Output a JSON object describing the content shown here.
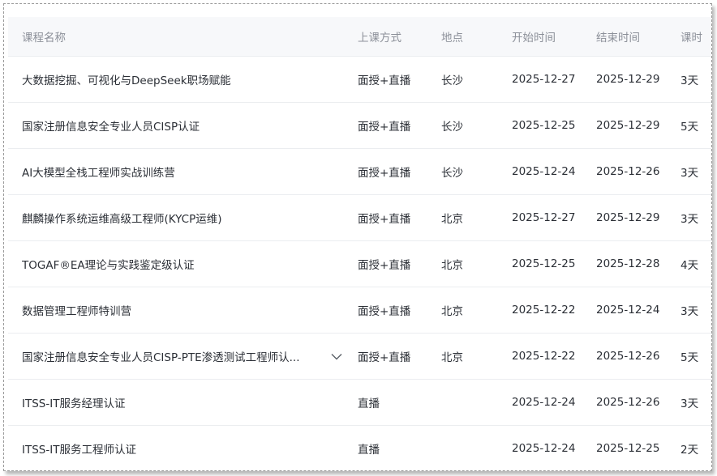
{
  "columns": {
    "name": "课程名称",
    "mode": "上课方式",
    "location": "地点",
    "start": "开始时间",
    "end": "结束时间",
    "days": "课时"
  },
  "rows": [
    {
      "name": "大数据挖掘、可视化与DeepSeek职场赋能",
      "mode": "面授+直播",
      "location": "长沙",
      "start": "2025-12-27",
      "end": "2025-12-29",
      "days": "3天"
    },
    {
      "name": "国家注册信息安全专业人员CISP认证",
      "mode": "面授+直播",
      "location": "长沙",
      "start": "2025-12-25",
      "end": "2025-12-29",
      "days": "5天"
    },
    {
      "name": "AI大模型全栈工程师实战训练营",
      "mode": "面授+直播",
      "location": "长沙",
      "start": "2025-12-24",
      "end": "2025-12-26",
      "days": "3天"
    },
    {
      "name": "麒麟操作系统运维高级工程师(KYCP运维)",
      "mode": "面授+直播",
      "location": "北京",
      "start": "2025-12-27",
      "end": "2025-12-29",
      "days": "3天"
    },
    {
      "name": "TOGAF®EA理论与实践鉴定级认证",
      "mode": "面授+直播",
      "location": "北京",
      "start": "2025-12-25",
      "end": "2025-12-28",
      "days": "4天"
    },
    {
      "name": "数据管理工程师特训营",
      "mode": "面授+直播",
      "location": "北京",
      "start": "2025-12-22",
      "end": "2025-12-24",
      "days": "3天"
    },
    {
      "name": "国家注册信息安全专业人员CISP-PTE渗透测试工程师认...",
      "mode": "面授+直播",
      "location": "北京",
      "start": "2025-12-22",
      "end": "2025-12-26",
      "days": "5天",
      "expandable": true
    },
    {
      "name": "ITSS-IT服务经理认证",
      "mode": "直播",
      "location": "",
      "start": "2025-12-24",
      "end": "2025-12-26",
      "days": "3天"
    },
    {
      "name": "ITSS-IT服务工程师认证",
      "mode": "直播",
      "location": "",
      "start": "2025-12-24",
      "end": "2025-12-25",
      "days": "2天"
    }
  ]
}
